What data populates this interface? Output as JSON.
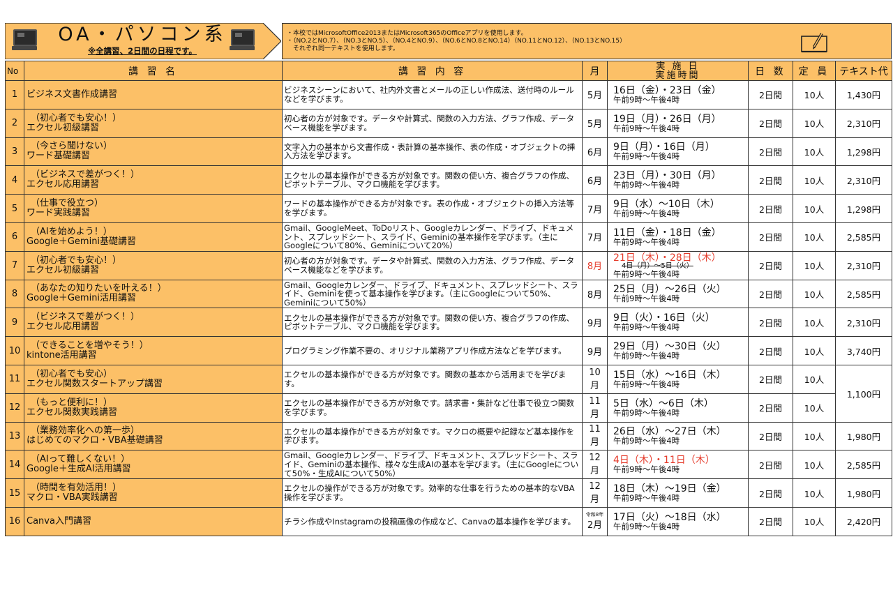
{
  "banner": {
    "title": "OA・パソコン系",
    "subtitle": "※全講習、2日間の日程です。",
    "left_icon": "computer-icon",
    "right_icon": "computer-icon"
  },
  "notes": {
    "lines": [
      "・本校ではMicrosoftOffice2013またはMicrosoft365のOfficeアプリを使用します。",
      "・（NO.2とNO.7）、（NO.3とNO.5）、（NO.4とNO.9）、（NO.6とNO.8とNO.14）（NO.11とNO.12）、（NO.13とNO.15）",
      "　それぞれ同一テキストを使用します。"
    ],
    "icon": "notebook-pencil-icon"
  },
  "colors": {
    "header_bg": "#fcc067",
    "highlight": "#e53a2a"
  },
  "headers": {
    "no": "No",
    "name": "講 習 名",
    "content": "講 習 内 容",
    "month": "月",
    "date_line1": "実 施 日",
    "date_line2": "実施時間",
    "days": "日 数",
    "capacity": "定 員",
    "text_fee": "テキスト代"
  },
  "rows": [
    {
      "no": "1",
      "name1": "ビジネス文書作成講習",
      "name2": "",
      "desc": "ビジネスシーンにおいて、社内外文書とメールの正しい作成法、送付時のルールなどを学びます。",
      "month": "5月",
      "date": "16日（金）・23日（金）",
      "time": "午前9時～午後4時",
      "days": "2日間",
      "cap": "10人",
      "fee": "1,430円"
    },
    {
      "no": "2",
      "name1": "（初心者でも安心！）",
      "name2": "エクセル初級講習",
      "desc": "初心者の方が対象です。データや計算式、関数の入力方法、グラフ作成、データベース機能を学びます。",
      "month": "5月",
      "date": "19日（月）・26日（月）",
      "time": "午前9時～午後4時",
      "days": "2日間",
      "cap": "10人",
      "fee": "2,310円"
    },
    {
      "no": "3",
      "name1": "（今さら聞けない）",
      "name2": "ワード基礎講習",
      "desc": "文字入力の基本から文書作成・表計算の基本操作、表の作成・オブジェクトの挿入方法を学びます。",
      "month": "6月",
      "date": "9日（月）・16日（月）",
      "time": "午前9時～午後4時",
      "days": "2日間",
      "cap": "10人",
      "fee": "1,298円"
    },
    {
      "no": "4",
      "name1": "（ビジネスで差がつく！）",
      "name2": "エクセル応用講習",
      "desc": "エクセルの基本操作ができる方が対象です。関数の使い方、複合グラフの作成、ピボットテーブル、マクロ機能を学びます。",
      "month": "6月",
      "date": "23日（月）・30日（月）",
      "time": "午前9時～午後4時",
      "days": "2日間",
      "cap": "10人",
      "fee": "2,310円"
    },
    {
      "no": "5",
      "name1": "（仕事で役立つ）",
      "name2": "ワード実践講習",
      "desc": "ワードの基本操作ができる方が対象です。表の作成・オブジェクトの挿入方法等を学びます。",
      "month": "7月",
      "date": "9日（水）～10日（木）",
      "time": "午前9時～午後4時",
      "days": "2日間",
      "cap": "10人",
      "fee": "1,298円"
    },
    {
      "no": "6",
      "name1": "（AIを始めよう！）",
      "name2": "Google＋Gemini基礎講習",
      "desc": "Gmail、GoogleMeet、ToDoリスト、Googleカレンダー、ドライブ、ドキュメント、スプレッドシート、スライド、Geminiの基本操作を学びます。（主にGoogleについて80%、Geminiについて20%）",
      "month": "7月",
      "date": "11日（金）・18日（金）",
      "time": "午前9時～午後4時",
      "days": "2日間",
      "cap": "10人",
      "fee": "2,585円"
    },
    {
      "no": "7",
      "name1": "（初心者でも安心！）",
      "name2": "エクセル初級講習",
      "desc": "初心者の方が対象です。データや計算式、関数の入力方法、グラフ作成、データベース機能などを学びます。",
      "month": "8月",
      "month_red": true,
      "date": "21日（木）・28日（木）",
      "date_red": true,
      "old_date": "4日（月）～5日（火）",
      "time": "午前9時～午後4時",
      "days": "2日間",
      "cap": "10人",
      "fee": "2,310円"
    },
    {
      "no": "8",
      "name1": "（あなたの知りたいを叶える！）",
      "name2": "Google＋Gemini活用講習",
      "desc": "Gmail、Googleカレンダー、ドライブ、ドキュメント、スプレッドシート、スライド、Geminiを使って基本操作を学びます。（主にGoogleについて50%、Geminiについて50%）",
      "month": "8月",
      "date": "25日（月）～26日（火）",
      "time": "午前9時～午後4時",
      "days": "2日間",
      "cap": "10人",
      "fee": "2,585円"
    },
    {
      "no": "9",
      "name1": "（ビジネスで差がつく！）",
      "name2": "エクセル応用講習",
      "desc": "エクセルの基本操作ができる方が対象です。関数の使い方、複合グラフの作成、ピボットテーブル、マクロ機能を学びます。",
      "month": "9月",
      "date": "9日（火）・16日（火）",
      "time": "午前9時～午後4時",
      "days": "2日間",
      "cap": "10人",
      "fee": "2,310円"
    },
    {
      "no": "10",
      "name1": "（できることを増やそう！）",
      "name2": "kintone活用講習",
      "desc": "プログラミング作業不要の、オリジナル業務アプリ作成方法などを学びます。",
      "month": "9月",
      "date": "29日（月）～30日（火）",
      "time": "午前9時～午後4時",
      "days": "2日間",
      "cap": "10人",
      "fee": "3,740円"
    },
    {
      "no": "11",
      "name1": "（初心者でも安心）",
      "name2": "エクセル関数スタートアップ講習",
      "desc": "エクセルの基本操作ができる方が対象です。関数の基本から活用までを学びます。",
      "month": "10月",
      "date": "15日（水）～16日（木）",
      "time": "午前9時～午後4時",
      "days": "2日間",
      "cap": "10人",
      "fee": "1,100円",
      "fee_rowspan": 2
    },
    {
      "no": "12",
      "name1": "（もっと便利に！）",
      "name2": "エクセル関数実践講習",
      "desc": "エクセルの基本操作ができる方が対象です。請求書・集計など仕事で役立つ関数を学びます。",
      "month": "11月",
      "date": "5日（水）～6日（木）",
      "time": "午前9時～午後4時",
      "days": "2日間",
      "cap": "10人",
      "fee": "",
      "fee_skip": true
    },
    {
      "no": "13",
      "name1": "（業務効率化への第一歩）",
      "name2": "はじめてのマクロ・VBA基礎講習",
      "desc": "エクセルの基本操作ができる方が対象です。マクロの概要や記録など基本操作を学びます。",
      "month": "11月",
      "date": "26日（水）～27日（木）",
      "time": "午前9時～午後4時",
      "days": "2日間",
      "cap": "10人",
      "fee": "1,980円"
    },
    {
      "no": "14",
      "name1": "（AIって難しくない！）",
      "name2": "Google＋生成AI活用講習",
      "desc": "Gmail、Googleカレンダー、ドライブ、ドキュメント、スプレッドシート、スライド、Geminiの基本操作、様々な生成AIの基本を学びます。（主にGoogleについて50%・生成AIについて50%）",
      "month": "12月",
      "date": "4日（木）・11日（木）",
      "date_red": true,
      "time": "午前9時～午後4時",
      "days": "2日間",
      "cap": "10人",
      "fee": "2,585円"
    },
    {
      "no": "15",
      "name1": "（時間を有効活用！）",
      "name2": "マクロ・VBA実践講習",
      "desc": "エクセルの操作ができる方が対象です。効率的な仕事を行うための基本的なVBA操作を学びます。",
      "month": "12月",
      "date": "18日（木）～19日（金）",
      "time": "午前9時～午後4時",
      "days": "2日間",
      "cap": "10人",
      "fee": "1,980円"
    },
    {
      "no": "16",
      "name1": "Canva入門講習",
      "name2": "",
      "desc": "チラシ作成やInstagramの投稿画像の作成など、Canvaの基本操作を学びます。",
      "month": "2月",
      "month_pre": "令和8年",
      "date": "17日（火）～18日（水）",
      "time": "午前9時～午後4時",
      "days": "2日間",
      "cap": "10人",
      "fee": "2,420円"
    }
  ]
}
